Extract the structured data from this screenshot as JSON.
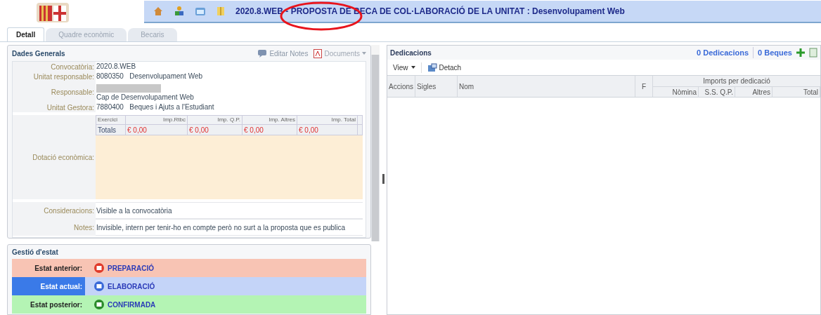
{
  "header": {
    "title": "2020.8.WEB - PROPOSTA DE BECA DE COL·LABORACIÓ DE LA UNITAT : Desenvolupament Web"
  },
  "tabs": [
    {
      "label": "Detall",
      "selected": true
    },
    {
      "label": "Quadre econòmic",
      "selected": false
    },
    {
      "label": "Becaris",
      "selected": false
    }
  ],
  "general": {
    "title": "Dades Generals",
    "actions": [
      "Editar Notes",
      "Documents"
    ],
    "fields": [
      {
        "label": "Convocatòria:",
        "value": "2020.8.WEB",
        "redacted": false
      },
      {
        "label": "Unitat responsable:",
        "value": "8080350   Desenvolupament Web",
        "redacted": false
      },
      {
        "label": "Responsable:",
        "value": "Cap de Desenvolupament Web",
        "redacted": true
      },
      {
        "label": "Unitat Gestora:",
        "value": "7880400   Beques i Ajuts a l'Estudiant",
        "redacted": false
      }
    ],
    "budget": {
      "label": "Dotació econòmica:",
      "columns": [
        "Exercici",
        "Imp.Rtbc",
        "Imp. Q.P.",
        "Imp. Altres",
        "Imp. Total"
      ],
      "rows": [
        [
          "Totals",
          "€ 0,00",
          "€ 0,00",
          "€ 0,00",
          "€ 0,00"
        ]
      ]
    },
    "notes": [
      {
        "label": "Consideracions:",
        "value": "Visible a la convocatòria"
      },
      {
        "label": "Notes:",
        "value": "Invisible, intern per tenir-ho en compte però no surt a la proposta que es publica"
      }
    ]
  },
  "status": {
    "title": "Gestió d'estat",
    "rows": [
      {
        "kind": "previous",
        "label": "Estat anterior:",
        "value": "PREPARACIÓ"
      },
      {
        "kind": "current",
        "label": "Estat actual:",
        "value": "ELABORACIÓ"
      },
      {
        "kind": "next",
        "label": "Estat posterior:",
        "value": "CONFIRMADA"
      }
    ]
  },
  "dedications": {
    "title": "Dedicacions",
    "counts": [
      "0 Dedicacions",
      "0 Beques"
    ],
    "toolbar": [
      "View",
      "Detach"
    ],
    "columns": [
      "Accions",
      "Sigles",
      "Nom",
      "F"
    ],
    "group": "Imports per dedicació",
    "subcolumns": [
      "Nòmina",
      "S.S. Q.P.",
      "Altres",
      "Total"
    ]
  }
}
